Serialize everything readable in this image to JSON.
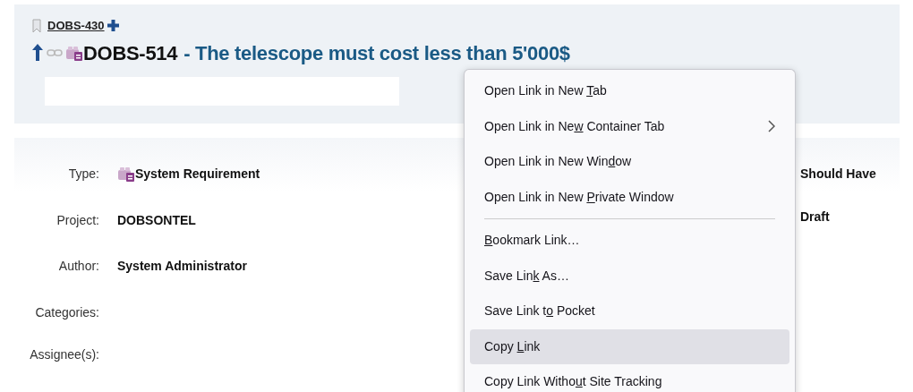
{
  "breadcrumb": {
    "parent_id": "DOBS-430"
  },
  "issue": {
    "id": "DOBS-514",
    "separator": "-",
    "title": "The telescope must cost less than 5'000$"
  },
  "details_left": [
    {
      "label": "Type:",
      "value": "System Requirement",
      "kind": "type"
    },
    {
      "label": "Project:",
      "value": "DOBSONTEL",
      "kind": "text"
    },
    {
      "label": "Author:",
      "value": "System Administrator",
      "kind": "text"
    },
    {
      "label": "Categories:",
      "kind": "empty"
    },
    {
      "label": "Assignee(s):",
      "kind": "empty"
    }
  ],
  "details_right": [
    {
      "value": "Should Have"
    },
    {
      "value": "Draft"
    }
  ],
  "context_menu": [
    {
      "before": "Open Link in New ",
      "accel": "T",
      "after": "ab",
      "selected": false
    },
    {
      "before": "Open Link in Ne",
      "accel": "w",
      "after": " Container Tab",
      "submenu": true,
      "selected": false
    },
    {
      "before": "Open Link in New Win",
      "accel": "d",
      "after": "ow",
      "selected": false
    },
    {
      "before": "Open Link in New ",
      "accel": "P",
      "after": "rivate Window",
      "selected": false
    },
    {
      "kind": "separator"
    },
    {
      "accel": "B",
      "after": "ookmark Link…",
      "selected": false
    },
    {
      "before": "Save Lin",
      "accel": "k",
      "after": " As…",
      "selected": false
    },
    {
      "before": "Save Link t",
      "accel": "o",
      "after": " Pocket",
      "selected": false
    },
    {
      "before": "Copy ",
      "accel": "L",
      "after": "ink",
      "selected": true
    },
    {
      "before": "Copy Link Witho",
      "accel": "u",
      "after": "t Site Tracking",
      "selected": false
    }
  ]
}
